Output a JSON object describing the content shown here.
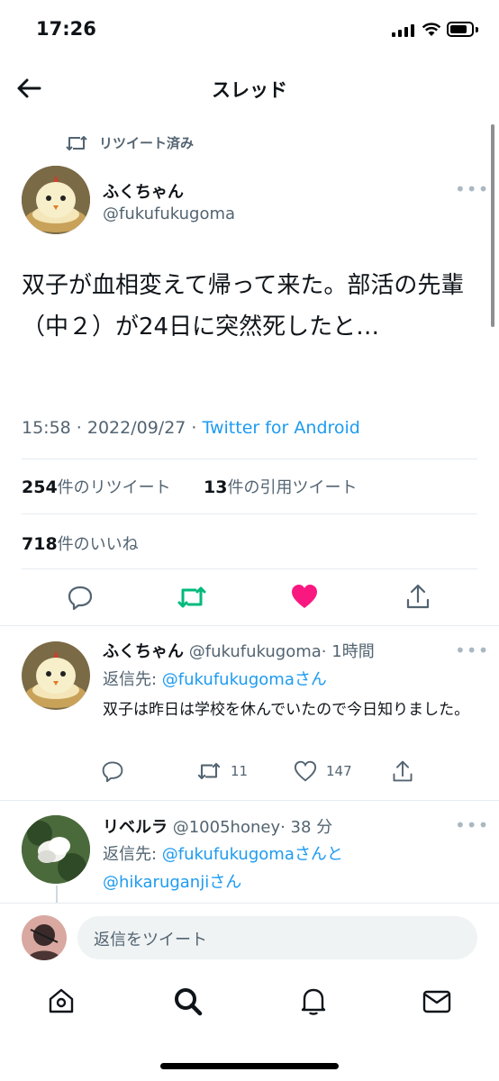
{
  "status_bar": {
    "time": "17:26"
  },
  "header": {
    "title": "スレッド"
  },
  "retweet_notice": "リツイート済み",
  "main_tweet": {
    "name": "ふくちゃん",
    "handle": "@fukufukugoma",
    "text": "双子が血相変えて帰って来た。部活の先輩（中２）が24日に突然死したと…",
    "time": "15:58 · 2022/09/27 · ",
    "source": "Twitter for Android",
    "retweets": "254",
    "retweets_label": "件のリツイート",
    "quotes": "13",
    "quotes_label": "件の引用ツイート",
    "likes": "718",
    "likes_label": "件のいいね"
  },
  "reply1": {
    "name": "ふくちゃん",
    "handle": "@fukufukugoma",
    "time": "· 1時間",
    "reply_to_prefix": "返信先: ",
    "reply_to_user": "@fukufukugoma",
    "reply_to_suffix": "さん",
    "text": "双子は昨日は学校を休んでいたので今日知りました。",
    "retweets": "11",
    "likes": "147"
  },
  "reply2": {
    "name": "リベルラ",
    "handle": "@1005honey",
    "time": "· 38 分",
    "reply_to_prefix": "返信先: ",
    "reply_to_user1": "@fukufukugoma",
    "reply_to_mid": "さんと",
    "reply_to_user2": "@hikaruganji",
    "reply_to_suffix": "さん"
  },
  "compose": {
    "placeholder": "返信をツイート"
  },
  "colors": {
    "accent": "#1d9bf0",
    "retweet": "#00ba7c",
    "like": "#f91880"
  }
}
